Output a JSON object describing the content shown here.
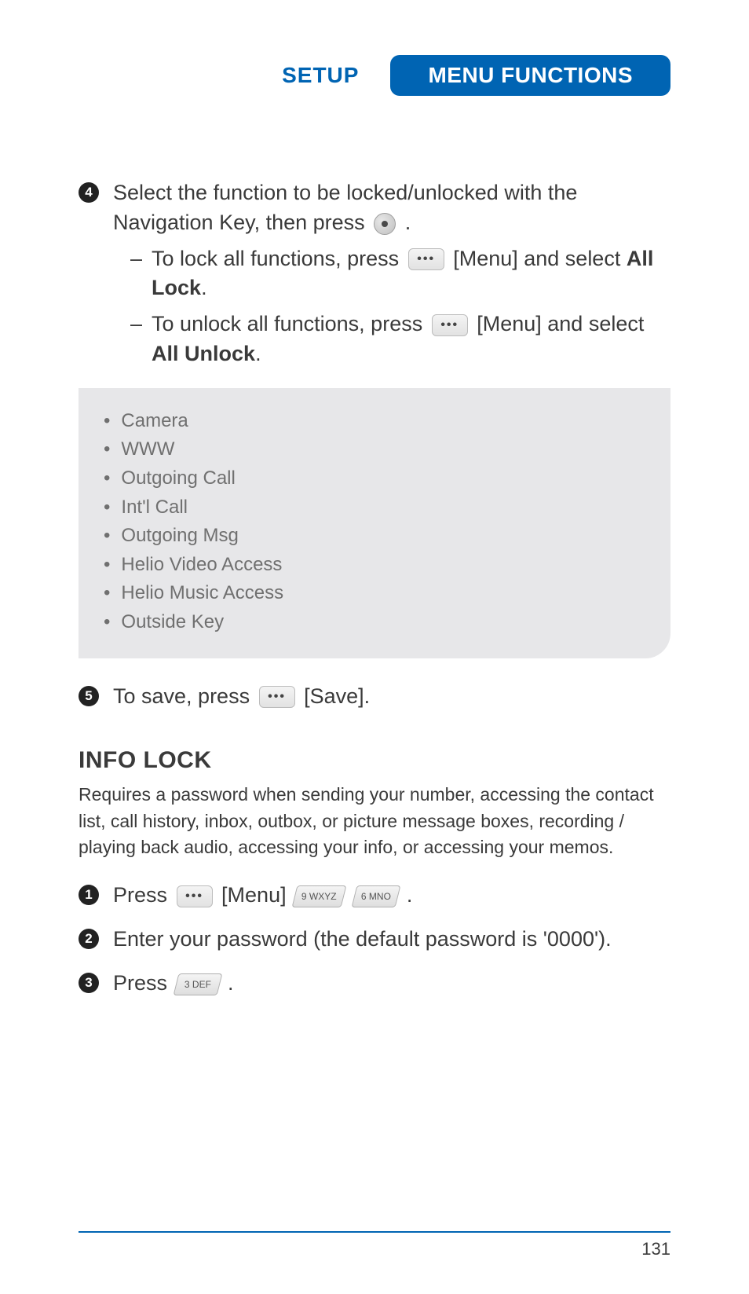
{
  "header": {
    "setup": "SETUP",
    "menu_functions": "MENU FUNCTIONS"
  },
  "step4": {
    "number": "4",
    "text_a": "Select the function to be locked/unlocked with the Navigation Key, then press ",
    "text_b": " .",
    "sub1_a": "To lock all functions, press ",
    "sub1_b": " [Menu] and select ",
    "sub1_bold": "All Lock",
    "sub1_c": ".",
    "sub2_a": "To unlock all functions, press ",
    "sub2_b": " [Menu] and select ",
    "sub2_bold": "All Unlock",
    "sub2_c": "."
  },
  "functions_box": {
    "items": [
      "Camera",
      "WWW",
      "Outgoing Call",
      "Int'l Call",
      "Outgoing Msg",
      "Helio Video Access",
      "Helio Music Access",
      "Outside Key"
    ]
  },
  "step5": {
    "number": "5",
    "text_a": "To save, press ",
    "text_b": " [Save]."
  },
  "info_lock": {
    "title": "INFO LOCK",
    "desc": "Requires a password when sending your number, accessing the contact list, call history, inbox, outbox, or picture message boxes, recording / playing back audio, accessing your info, or accessing your memos."
  },
  "info_steps": {
    "s1_number": "1",
    "s1_a": "Press ",
    "s1_b": " [Menu] ",
    "s1_c": " .",
    "key9": "9 WXYZ",
    "key6": "6 MNO",
    "s2_number": "2",
    "s2_text": "Enter your password (the default password is '0000').",
    "s3_number": "3",
    "s3_a": "Press ",
    "key3": "3 DEF",
    "s3_b": " ."
  },
  "page_number": "131"
}
